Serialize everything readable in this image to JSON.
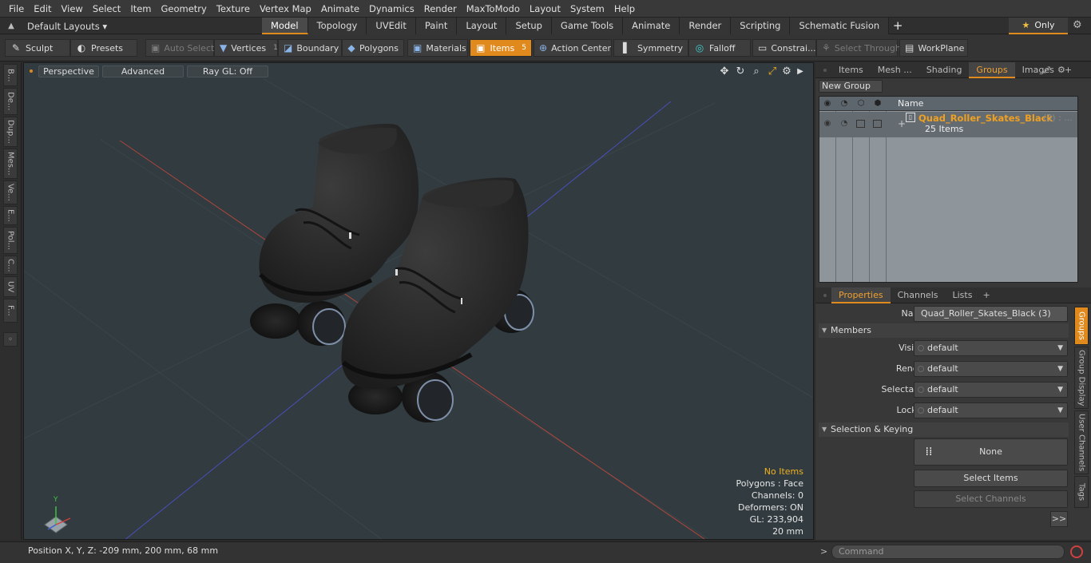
{
  "menu": [
    "File",
    "Edit",
    "View",
    "Select",
    "Item",
    "Geometry",
    "Texture",
    "Vertex Map",
    "Animate",
    "Dynamics",
    "Render",
    "MaxToModo",
    "Layout",
    "System",
    "Help"
  ],
  "layouts": {
    "label": "Default Layouts ▾"
  },
  "tabs": [
    "Model",
    "Topology",
    "UVEdit",
    "Paint",
    "Layout",
    "Setup",
    "Game Tools",
    "Animate",
    "Render",
    "Scripting",
    "Schematic Fusion"
  ],
  "tabs_plus": "+",
  "only": {
    "star": "★",
    "label": "Only"
  },
  "toolbar": {
    "sculpt": "Sculpt",
    "presets": "Presets",
    "auto_select": "Auto Select",
    "vertices": "Vertices",
    "vertices_count": "1",
    "boundary": "Boundary",
    "polygons": "Polygons",
    "materials": "Materials",
    "items": "Items",
    "items_count": "5",
    "action_center": "Action Center",
    "symmetry": "Symmetry",
    "falloff": "Falloff",
    "constraints": "Constrai...",
    "select_through": "Select Through",
    "workplane": "WorkPlane"
  },
  "left_tabs": [
    "B...",
    "De...",
    "Dup...",
    "Mes...",
    "Ve...",
    "E...",
    "Pol...",
    "C...",
    "UV",
    "F..."
  ],
  "viewport": {
    "perspective": "Perspective",
    "advanced": "Advanced",
    "raygl": "Ray GL: Off",
    "stats": {
      "selection": "No Items",
      "polygons": "Polygons : Face",
      "channels": "Channels: 0",
      "deformers": "Deformers: ON",
      "gl": "GL: 233,904",
      "scale": "20 mm"
    },
    "axis_y": "Y"
  },
  "top_panel": {
    "tabs": [
      "Items",
      "Mesh ...",
      "Shading",
      "Groups",
      "Images"
    ],
    "active": "Groups",
    "plus": "+",
    "new_group": "New Group",
    "col_name": "Name",
    "group_name": "Quad_Roller_Skates_Black",
    "group_suffix": "(3) : ...",
    "group_items": "25 Items"
  },
  "props_panel": {
    "tabs": [
      "Properties",
      "Channels",
      "Lists"
    ],
    "active": "Properties",
    "plus": "+",
    "name_label": "Name",
    "name_value": "Quad_Roller_Skates_Black (3)",
    "members_section": "Members",
    "visible_label": "Visible",
    "visible_value": "default",
    "render_label": "Render",
    "render_value": "default",
    "selectable_label": "Selectable",
    "selectable_value": "default",
    "locked_label": "Locked",
    "locked_value": "default",
    "selkey_section": "Selection & Keying",
    "none_label": "None",
    "select_items": "Select Items",
    "select_channels": "Select Channels",
    "more": ">>",
    "side_tabs": [
      "Groups",
      "Group Display",
      "User Channels",
      "Tags"
    ]
  },
  "status": {
    "position": "Position X, Y, Z:   -209 mm, 200 mm, 68 mm"
  },
  "command": {
    "prompt": ">",
    "placeholder": "Command"
  }
}
